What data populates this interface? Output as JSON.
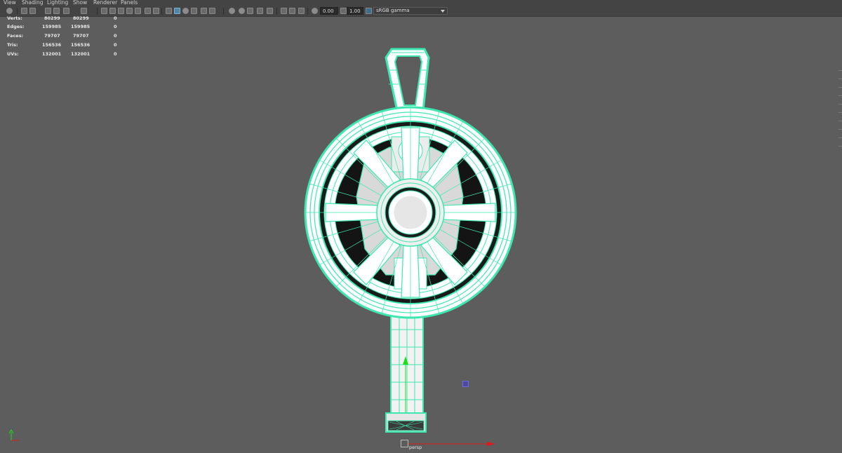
{
  "menubar": {
    "items": [
      "View",
      "Shading",
      "Lighting",
      "Show",
      "Renderer",
      "Panels"
    ]
  },
  "toolbar": {
    "exposure_value": "0.00",
    "gamma_value": "1.00",
    "color_space": "sRGB gamma",
    "icons": [
      "camera-select-icon",
      "camera-attributes-icon",
      "bookmarks-icon",
      "image-plane-icon",
      "grid-icon",
      "film-gate-icon",
      "resolution-gate-icon",
      "gate-mask-icon",
      "field-chart-icon",
      "safe-action-icon",
      "safe-title-icon",
      "wireframe-icon",
      "smooth-shade-icon",
      "default-material-icon",
      "textured-icon",
      "lights-icon",
      "shadows-icon",
      "screen-space-ao-icon",
      "motion-blur-icon",
      "anti-aliasing-icon",
      "depth-of-field-icon",
      "isolate-select-icon",
      "xray-icon",
      "xray-active-components-icon",
      "xray-joints-icon",
      "exposure-icon",
      "gamma-icon",
      "view-transform-icon"
    ]
  },
  "hud": {
    "rows": [
      {
        "label": "Verts:",
        "v1": "80299",
        "v2": "80299",
        "v3": "0"
      },
      {
        "label": "Edges:",
        "v1": "159985",
        "v2": "159985",
        "v3": "0"
      },
      {
        "label": "Faces:",
        "v1": "79707",
        "v2": "79707",
        "v3": "0"
      },
      {
        "label": "Tris:",
        "v1": "156536",
        "v2": "156536",
        "v3": "0"
      },
      {
        "label": "UVs:",
        "v1": "132001",
        "v2": "132001",
        "v3": "0"
      }
    ]
  },
  "viewport": {
    "camera_label": "persp",
    "background_color": "#5d5d5d",
    "wire_color": "#3de8b0",
    "axis_x_color": "#e01a1a",
    "axis_y_color": "#18e018"
  }
}
